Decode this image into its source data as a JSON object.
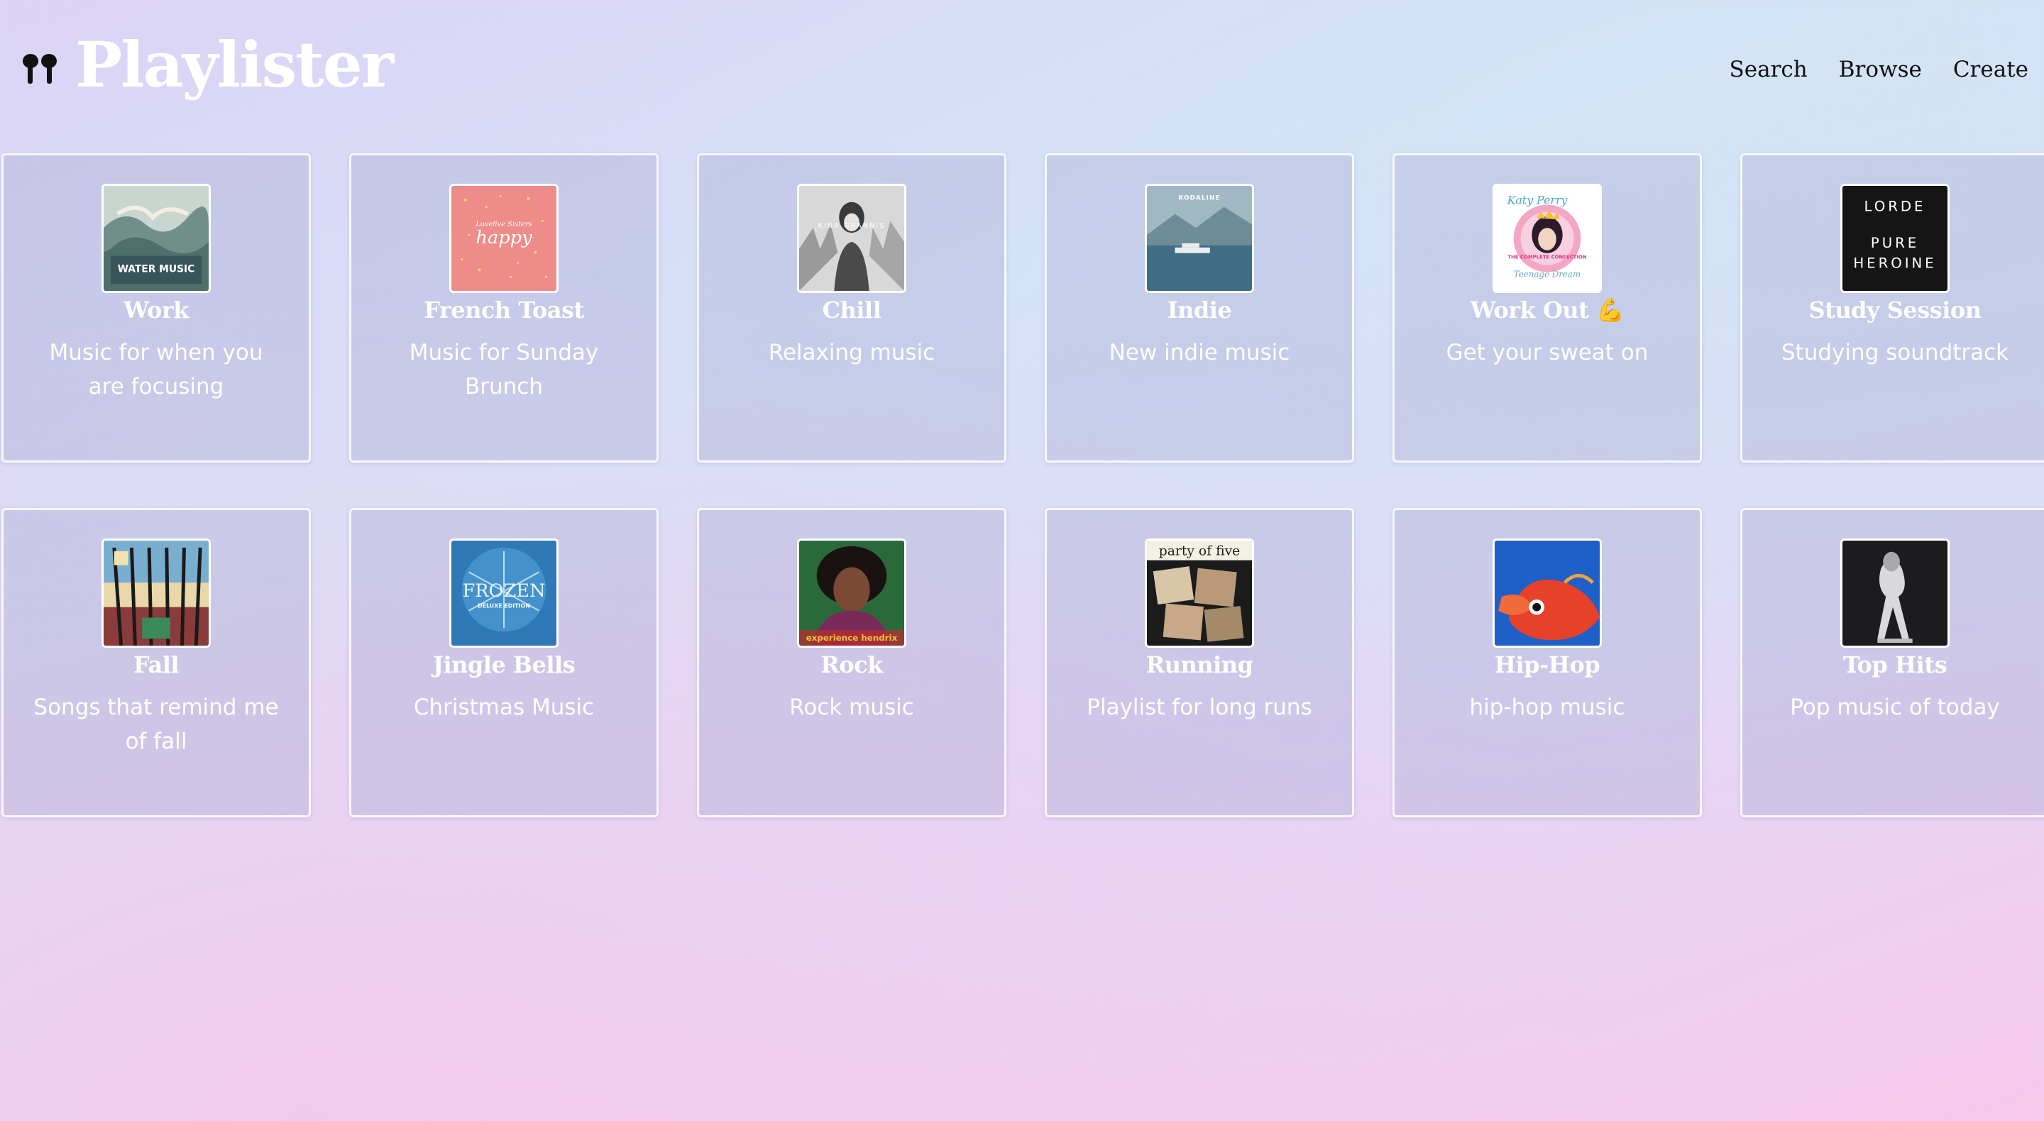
{
  "app": {
    "title": "Playlister",
    "logo_icon": "earbuds-icon"
  },
  "nav": {
    "items": [
      "Search",
      "Browse",
      "Create"
    ]
  },
  "colors": {
    "card_text": "#ffffff",
    "nav_text": "#111111",
    "card_border": "#ffffff"
  },
  "playlists": [
    {
      "title": "Work",
      "description": "Music for when you are focusing",
      "cover": "water-music-album-cover"
    },
    {
      "title": "French Toast",
      "description": "Music for Sunday Brunch",
      "cover": "happy-album-cover"
    },
    {
      "title": "Chill",
      "description": "Relaxing music",
      "cover": "kina-grannis-album-cover"
    },
    {
      "title": "Indie",
      "description": "New indie music",
      "cover": "kodaline-album-cover"
    },
    {
      "title": "Work Out 💪",
      "description": "Get your sweat on",
      "cover": "katy-perry-album-cover"
    },
    {
      "title": "Study Session",
      "description": "Studying soundtrack",
      "cover": "lorde-pure-heroine-album-cover"
    },
    {
      "title": "Fall",
      "description": "Songs that remind me of fall",
      "cover": "tame-impala-album-cover"
    },
    {
      "title": "Jingle Bells",
      "description": "Christmas Music",
      "cover": "frozen-album-cover"
    },
    {
      "title": "Rock",
      "description": "Rock music",
      "cover": "jimi-hendrix-album-cover"
    },
    {
      "title": "Running",
      "description": "Playlist for long runs",
      "cover": "party-of-five-album-cover"
    },
    {
      "title": "Hip-Hop",
      "description": "hip-hop music",
      "cover": "goldfish-album-cover"
    },
    {
      "title": "Top Hits",
      "description": "Pop music of today",
      "cover": "ariana-grande-album-cover"
    }
  ],
  "cover_text": {
    "water_music": [
      "WATER MUSIC"
    ],
    "happy": [
      "Lovelive Sisters",
      "happy"
    ],
    "kina": [
      "KINA GRANNIS"
    ],
    "kodaline": [
      "KODALINE"
    ],
    "katy": [
      "Katy Perry",
      "THE COMPLETE CONFECTION",
      "Teenage Dream"
    ],
    "lorde": [
      "LORDE",
      "PURE",
      "HEROINE"
    ],
    "frozen": [
      "FROZEN",
      "DELUXE EDITION"
    ],
    "hendrix": [
      "experience hendrix"
    ],
    "party": [
      "party of five"
    ]
  }
}
